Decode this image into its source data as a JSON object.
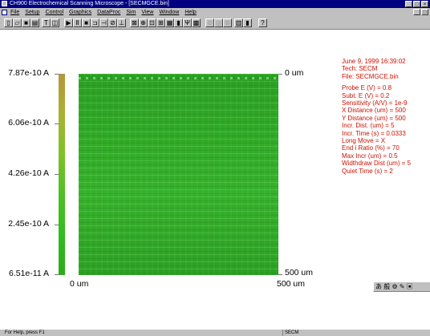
{
  "window": {
    "title": "CH900 Electrochemical Scanning Microscope - [SECMGCE.bin]",
    "min_glyph": "_",
    "max_glyph": "□",
    "close_glyph": "×"
  },
  "menu": [
    "File",
    "Setup",
    "Control",
    "Graphics",
    "DataProc",
    "Sim",
    "View",
    "Window",
    "Help"
  ],
  "toolbar_icons": [
    {
      "name": "new-file-icon",
      "glyph": "▯"
    },
    {
      "name": "open-file-icon",
      "glyph": "▱"
    },
    {
      "name": "save-icon",
      "glyph": "■"
    },
    {
      "name": "print-icon",
      "glyph": "▤"
    },
    {
      "name": "technique-icon",
      "glyph": "T"
    },
    {
      "name": "parameters-icon",
      "glyph": "◫"
    },
    {
      "name": "run-icon",
      "glyph": "▶"
    },
    {
      "name": "pause-icon",
      "glyph": "Ⅱ"
    },
    {
      "name": "stop-icon",
      "glyph": "■"
    },
    {
      "name": "reverse-icon",
      "glyph": "⊐"
    },
    {
      "name": "probe-icon",
      "glyph": "⊣"
    },
    {
      "name": "tip-approach-icon",
      "glyph": "⊘"
    },
    {
      "name": "step-icon",
      "glyph": "⊥"
    },
    {
      "name": "graph-icon",
      "glyph": "⊠"
    },
    {
      "name": "zoom-icon",
      "glyph": "⊕"
    },
    {
      "name": "cursor-icon",
      "glyph": "⊡"
    },
    {
      "name": "overlay-icon",
      "glyph": "⊞"
    },
    {
      "name": "color-map-icon",
      "glyph": "▦"
    },
    {
      "name": "bar-graph-icon",
      "glyph": "▮"
    },
    {
      "name": "parameters-graph-icon",
      "glyph": "Ψ"
    },
    {
      "name": "image-icon",
      "glyph": "▩"
    },
    {
      "name": "mark-icon",
      "glyph": "⊙"
    },
    {
      "name": "calibrate-icon",
      "glyph": "◎"
    },
    {
      "name": "simulate-icon",
      "glyph": "⊚"
    },
    {
      "name": "grid-icon",
      "glyph": "▥"
    },
    {
      "name": "device-icon",
      "glyph": "▮"
    },
    {
      "name": "help-icon",
      "glyph": "?"
    }
  ],
  "plot": {
    "colorbar_labels": [
      "7.87e-10 A",
      "6.06e-10 A",
      "4.26e-10 A",
      "2.45e-10 A",
      "6.51e-11 A"
    ],
    "y_axis_top": "0 um",
    "y_axis_bottom": "500 um",
    "x_axis_left": "0 um",
    "x_axis_right": "500 um"
  },
  "info": {
    "datetime": "June 9, 1999   16:39:02",
    "tech": "Tech: SECM",
    "file": "File: SECMGCE.bin",
    "params": [
      "Probe E (V) = 0.8",
      "Subt. E (V) = 0.2",
      "Sensitivity (A/V) = 1e-9",
      "X Distance (um) = 500",
      "Y Distance (um) = 500",
      "Incr. Dist. (um) = 5",
      "Incr. Time (s) = 0.0333",
      "Long Move = X",
      "End i Ratio (%) = 70",
      "Max Incr (um) = 0.5",
      "Widthdraw Dist (um) = 5",
      "Quiet Time (s) = 2"
    ]
  },
  "ime_bar": "あ 般 ⚙ ✎ ▣",
  "status": {
    "left": "For Help, press F1",
    "right": "SECM"
  }
}
